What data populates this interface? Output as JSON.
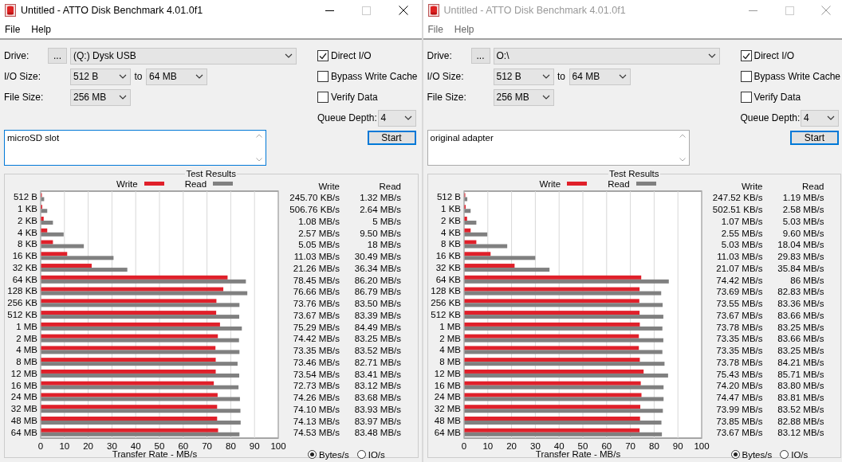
{
  "windows": [
    {
      "active": true,
      "title": "Untitled - ATTO Disk Benchmark 4.01.0f1",
      "menu": [
        "File",
        "Help"
      ],
      "drive_label": "Drive:",
      "browse_button": "...",
      "drive": "(Q:) Dysk USB",
      "io_size_label": "I/O Size:",
      "io_from": "512 B",
      "io_to_label": "to",
      "io_to": "64 MB",
      "file_size_label": "File Size:",
      "file_size": "256 MB",
      "options": [
        {
          "label": "Direct I/O",
          "checked": true
        },
        {
          "label": "Bypass Write Cache",
          "checked": false
        },
        {
          "label": "Verify Data",
          "checked": false
        }
      ],
      "queue_depth_label": "Queue Depth:",
      "queue_depth": "4",
      "start_button": "Start",
      "description": {
        "value": "microSD slot",
        "focused": true
      },
      "results": {
        "columns": [
          "Write",
          "Read"
        ],
        "rows": [
          {
            "write": "245.70 KB/s",
            "read": "1.32 MB/s"
          },
          {
            "write": "506.76 KB/s",
            "read": "2.64 MB/s"
          },
          {
            "write": "1.08 MB/s",
            "read": "5 MB/s"
          },
          {
            "write": "2.57 MB/s",
            "read": "9.50 MB/s"
          },
          {
            "write": "5.05 MB/s",
            "read": "18 MB/s"
          },
          {
            "write": "11.03 MB/s",
            "read": "30.49 MB/s"
          },
          {
            "write": "21.26 MB/s",
            "read": "36.34 MB/s"
          },
          {
            "write": "78.45 MB/s",
            "read": "86.20 MB/s"
          },
          {
            "write": "76.66 MB/s",
            "read": "86.79 MB/s"
          },
          {
            "write": "73.76 MB/s",
            "read": "83.50 MB/s"
          },
          {
            "write": "73.67 MB/s",
            "read": "83.39 MB/s"
          },
          {
            "write": "75.29 MB/s",
            "read": "84.49 MB/s"
          },
          {
            "write": "74.42 MB/s",
            "read": "83.25 MB/s"
          },
          {
            "write": "73.35 MB/s",
            "read": "83.52 MB/s"
          },
          {
            "write": "73.46 MB/s",
            "read": "82.71 MB/s"
          },
          {
            "write": "73.54 MB/s",
            "read": "83.41 MB/s"
          },
          {
            "write": "72.73 MB/s",
            "read": "83.12 MB/s"
          },
          {
            "write": "74.26 MB/s",
            "read": "83.68 MB/s"
          },
          {
            "write": "74.10 MB/s",
            "read": "83.93 MB/s"
          },
          {
            "write": "74.13 MB/s",
            "read": "83.97 MB/s"
          },
          {
            "write": "74.53 MB/s",
            "read": "83.48 MB/s"
          }
        ],
        "units": [
          {
            "label": "Bytes/s",
            "selected": true
          },
          {
            "label": "IO/s",
            "selected": false
          }
        ],
        "chart_data": {
          "type": "bar",
          "orientation": "horizontal",
          "title": "Test Results",
          "xlabel": "Transfer Rate - MB/s",
          "categories": [
            "512 B",
            "1 KB",
            "2 KB",
            "4 KB",
            "8 KB",
            "16 KB",
            "32 KB",
            "64 KB",
            "128 KB",
            "256 KB",
            "512 KB",
            "1 MB",
            "2 MB",
            "4 MB",
            "8 MB",
            "12 MB",
            "16 MB",
            "24 MB",
            "32 MB",
            "48 MB",
            "64 MB"
          ],
          "series": [
            {
              "name": "Write",
              "color": "#e0202a",
              "values": [
                0.2,
                0.5,
                1.1,
                2.6,
                5,
                11,
                21.3,
                78.5,
                76.7,
                73.8,
                73.7,
                75.3,
                74.4,
                73.4,
                73.5,
                73.5,
                72.7,
                74.3,
                74.1,
                74.1,
                74.5
              ]
            },
            {
              "name": "Read",
              "color": "#808080",
              "values": [
                1.3,
                2.6,
                5,
                9.5,
                18,
                30.5,
                36.3,
                86.2,
                86.8,
                83.5,
                83.4,
                84.5,
                83.3,
                83.5,
                82.7,
                83.4,
                83.1,
                83.7,
                83.9,
                84,
                83.5
              ]
            }
          ],
          "xlim": [
            0,
            100
          ],
          "xticks": [
            0,
            10,
            20,
            30,
            40,
            50,
            60,
            70,
            80,
            90,
            100
          ],
          "grid": true
        }
      }
    },
    {
      "active": false,
      "title": "Untitled - ATTO Disk Benchmark 4.01.0f1",
      "menu": [
        "File",
        "Help"
      ],
      "drive_label": "Drive:",
      "browse_button": "...",
      "drive": "O:\\",
      "io_size_label": "I/O Size:",
      "io_from": "512 B",
      "io_to_label": "to",
      "io_to": "64 MB",
      "file_size_label": "File Size:",
      "file_size": "256 MB",
      "options": [
        {
          "label": "Direct I/O",
          "checked": true
        },
        {
          "label": "Bypass Write Cache",
          "checked": false
        },
        {
          "label": "Verify Data",
          "checked": false
        }
      ],
      "queue_depth_label": "Queue Depth:",
      "queue_depth": "4",
      "start_button": "Start",
      "description": {
        "value": "original adapter",
        "focused": false
      },
      "results": {
        "columns": [
          "Write",
          "Read"
        ],
        "rows": [
          {
            "write": "247.52 KB/s",
            "read": "1.19 MB/s"
          },
          {
            "write": "502.51 KB/s",
            "read": "2.58 MB/s"
          },
          {
            "write": "1.07 MB/s",
            "read": "5.03 MB/s"
          },
          {
            "write": "2.55 MB/s",
            "read": "9.60 MB/s"
          },
          {
            "write": "5.03 MB/s",
            "read": "18.04 MB/s"
          },
          {
            "write": "11.03 MB/s",
            "read": "29.83 MB/s"
          },
          {
            "write": "21.07 MB/s",
            "read": "35.84 MB/s"
          },
          {
            "write": "74.42 MB/s",
            "read": "86 MB/s"
          },
          {
            "write": "73.69 MB/s",
            "read": "82.83 MB/s"
          },
          {
            "write": "73.55 MB/s",
            "read": "83.36 MB/s"
          },
          {
            "write": "73.67 MB/s",
            "read": "83.66 MB/s"
          },
          {
            "write": "73.78 MB/s",
            "read": "83.25 MB/s"
          },
          {
            "write": "73.35 MB/s",
            "read": "83.66 MB/s"
          },
          {
            "write": "73.35 MB/s",
            "read": "83.25 MB/s"
          },
          {
            "write": "73.78 MB/s",
            "read": "84.21 MB/s"
          },
          {
            "write": "75.43 MB/s",
            "read": "85.71 MB/s"
          },
          {
            "write": "74.20 MB/s",
            "read": "83.80 MB/s"
          },
          {
            "write": "74.47 MB/s",
            "read": "83.81 MB/s"
          },
          {
            "write": "73.99 MB/s",
            "read": "83.52 MB/s"
          },
          {
            "write": "73.85 MB/s",
            "read": "82.88 MB/s"
          },
          {
            "write": "73.67 MB/s",
            "read": "83.12 MB/s"
          }
        ],
        "units": [
          {
            "label": "Bytes/s",
            "selected": true
          },
          {
            "label": "IO/s",
            "selected": false
          }
        ],
        "chart_data": {
          "type": "bar",
          "orientation": "horizontal",
          "title": "Test Results",
          "xlabel": "Transfer Rate - MB/s",
          "categories": [
            "512 B",
            "1 KB",
            "2 KB",
            "4 KB",
            "8 KB",
            "16 KB",
            "32 KB",
            "64 KB",
            "128 KB",
            "256 KB",
            "512 KB",
            "1 MB",
            "2 MB",
            "4 MB",
            "8 MB",
            "12 MB",
            "16 MB",
            "24 MB",
            "32 MB",
            "48 MB",
            "64 MB"
          ],
          "series": [
            {
              "name": "Write",
              "color": "#e0202a",
              "values": [
                0.2,
                0.5,
                1.1,
                2.6,
                5,
                11,
                21.1,
                74.4,
                73.7,
                73.6,
                73.7,
                73.8,
                73.4,
                73.4,
                73.8,
                75.4,
                74.2,
                74.5,
                74,
                73.9,
                73.7
              ]
            },
            {
              "name": "Read",
              "color": "#808080",
              "values": [
                1.2,
                2.6,
                5,
                9.6,
                18,
                29.8,
                35.8,
                86,
                82.8,
                83.4,
                83.7,
                83.3,
                83.7,
                83.3,
                84.2,
                85.7,
                83.8,
                83.8,
                83.5,
                82.9,
                83.1
              ]
            }
          ],
          "xlim": [
            0,
            100
          ],
          "xticks": [
            0,
            10,
            20,
            30,
            40,
            50,
            60,
            70,
            80,
            90,
            100
          ],
          "grid": true
        }
      }
    }
  ]
}
